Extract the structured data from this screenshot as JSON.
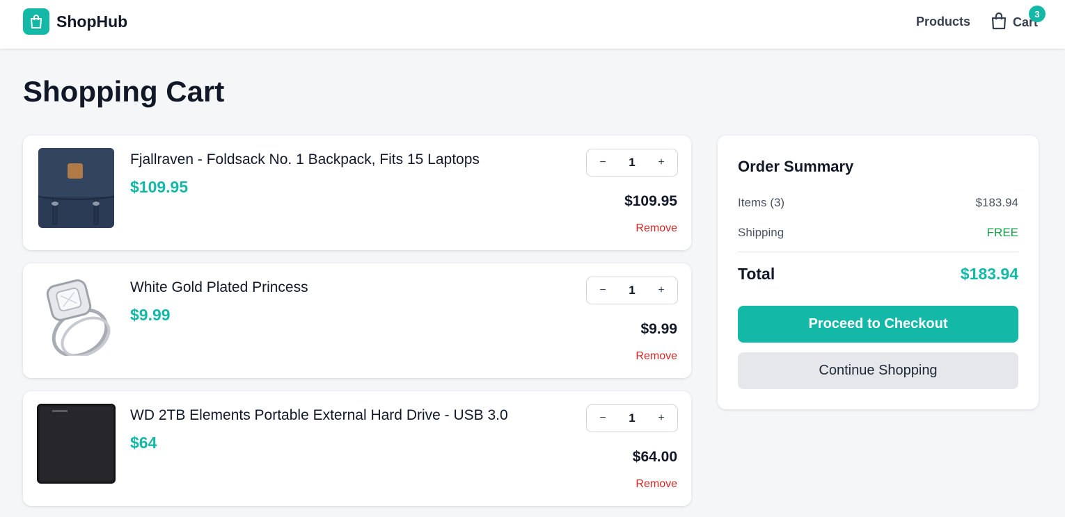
{
  "header": {
    "brand": "ShopHub",
    "nav_products": "Products",
    "nav_cart": "Cart",
    "cart_count": "3"
  },
  "page": {
    "title": "Shopping Cart"
  },
  "cart": {
    "items": [
      {
        "name": "Fjallraven - Foldsack No. 1 Backpack, Fits 15 Laptops",
        "price": "$109.95",
        "qty": "1",
        "line_total": "$109.95",
        "decrement": "−",
        "increment": "+",
        "remove": "Remove"
      },
      {
        "name": "White Gold Plated Princess",
        "price": "$9.99",
        "qty": "1",
        "line_total": "$9.99",
        "decrement": "−",
        "increment": "+",
        "remove": "Remove"
      },
      {
        "name": "WD 2TB Elements Portable External Hard Drive - USB 3.0",
        "price": "$64",
        "qty": "1",
        "line_total": "$64.00",
        "decrement": "−",
        "increment": "+",
        "remove": "Remove"
      }
    ]
  },
  "summary": {
    "title": "Order Summary",
    "items_label": "Items (3)",
    "items_value": "$183.94",
    "shipping_label": "Shipping",
    "shipping_value": "FREE",
    "total_label": "Total",
    "total_value": "$183.94",
    "checkout_label": "Proceed to Checkout",
    "continue_label": "Continue Shopping"
  },
  "colors": {
    "accent": "#14b8a6",
    "remove": "#dc2626",
    "free": "#16a34a"
  },
  "icons": {
    "brand": "shopping-bag-icon",
    "cart": "shopping-bag-outline-icon"
  }
}
